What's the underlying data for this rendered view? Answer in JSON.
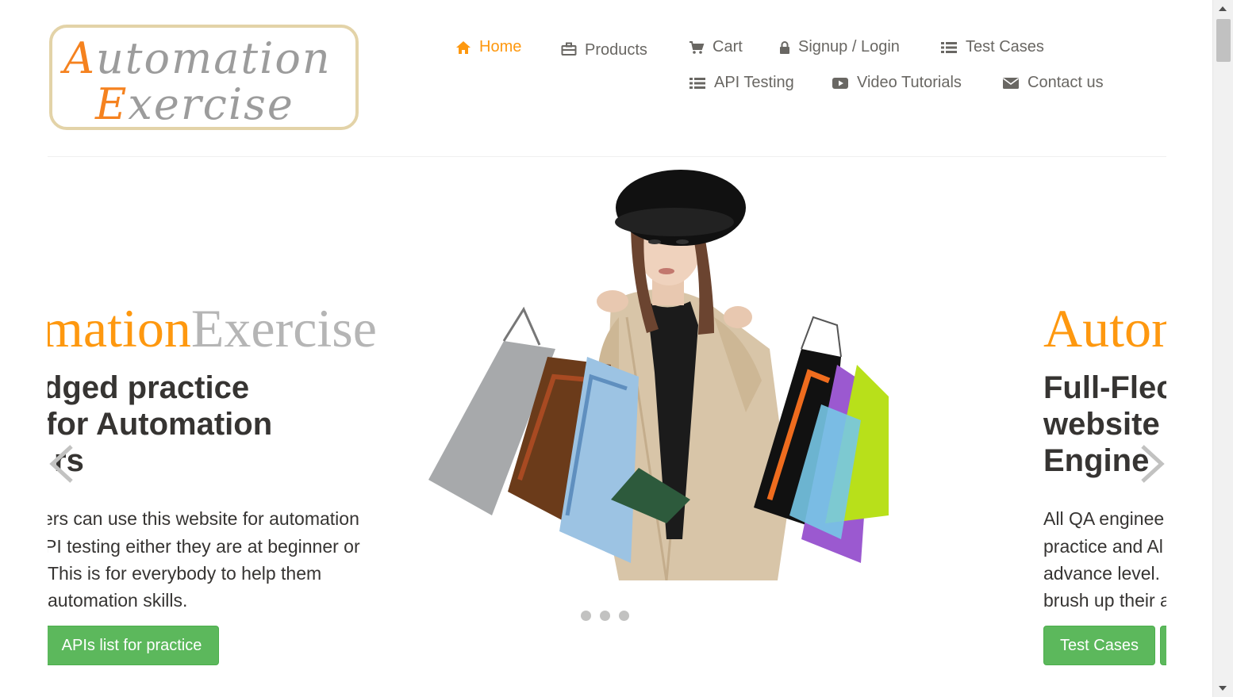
{
  "logo": {
    "line1_cap": "A",
    "line1_rest": "utomation",
    "line2_cap": "E",
    "line2_rest": "xercise"
  },
  "nav": {
    "home": "Home",
    "products": "Products",
    "cart": "Cart",
    "signup_login": "Signup / Login",
    "test_cases": "Test Cases",
    "api_testing": "API Testing",
    "video_tutorials": "Video Tutorials",
    "contact_us": "Contact us"
  },
  "colors": {
    "accent": "#fe980f",
    "text": "#696763",
    "button_green": "#5cb85c"
  },
  "carousel": {
    "left_slide": {
      "brand_orange": "mation",
      "brand_gray": "Exercise",
      "title_line1": "dged practice",
      "title_line2": " for Automation",
      "title_line3": "rs",
      "text_line1": "ers can use this website for automation",
      "text_line2": "PI testing either they are at beginner or",
      "text_line3": " This is for everybody to help them",
      "text_line4": "automation skills.",
      "button": "APIs list for practice"
    },
    "right_slide": {
      "brand_orange": "Auton",
      "title_line1": "Full-Flec",
      "title_line2": "website",
      "title_line3": "Engine",
      "text_line1": "All QA enginee",
      "text_line2": "practice and Al",
      "text_line3": "advance level.",
      "text_line4": "brush up their a",
      "button": "Test Cases"
    },
    "indicator_count": 3
  }
}
